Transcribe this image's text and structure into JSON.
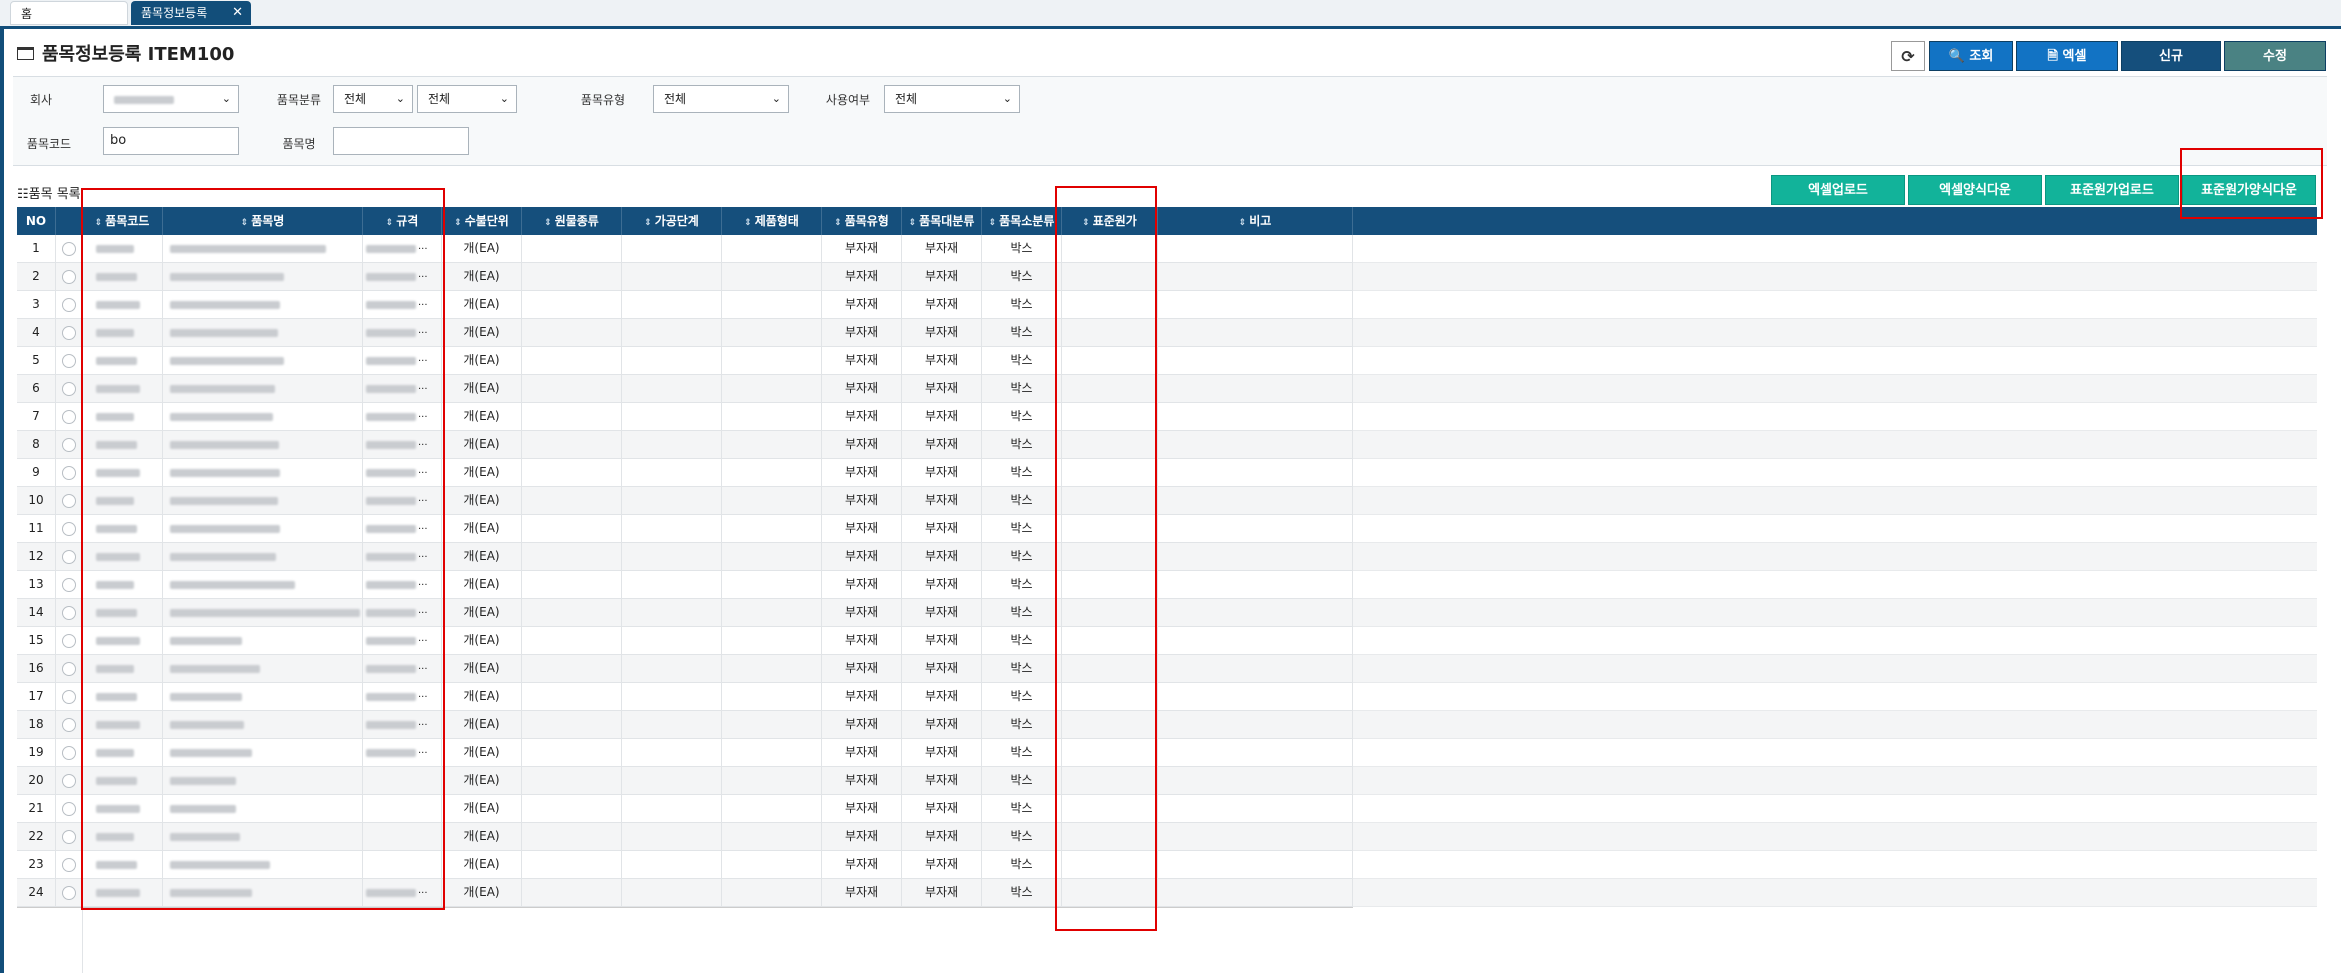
{
  "tabs": {
    "home": "홈",
    "active": "품목정보등록",
    "close": "✕"
  },
  "page": {
    "title": "품목정보등록 ITEM100"
  },
  "toolbar": {
    "refresh": "⟳",
    "search": "🔍 조회",
    "excel": "🗎 엑셀",
    "new": "신규",
    "edit": "수정"
  },
  "filters": {
    "company_label": "회사",
    "category_label": "품목분류",
    "category_value_1": "전체",
    "category_value_2": "전체",
    "type_label": "품목유형",
    "type_value": "전체",
    "use_label": "사용여부",
    "use_value": "전체",
    "code_label": "품목코드",
    "code_value": "bo",
    "name_label": "품목명",
    "name_value": ""
  },
  "list": {
    "title": "품목 목록",
    "buttons": {
      "excel_upload": "엑셀업로드",
      "excel_form_download": "엑셀양식다운",
      "std_cost_upload": "표준원가업로드",
      "std_cost_form_download": "표준원가양식다운"
    }
  },
  "grid": {
    "headers": {
      "no": "NO",
      "code": "품목코드",
      "name": "품목명",
      "spec": "규격",
      "unit": "수불단위",
      "material": "원물종류",
      "process": "가공단계",
      "shape": "제품형태",
      "item_type": "품목유형",
      "major": "품목대분류",
      "minor": "품목소분류",
      "std_cost": "표준원가",
      "note": "비고"
    },
    "rows": [
      {
        "no": "1",
        "unit": "개(EA)",
        "item_type": "부자재",
        "major": "부자재",
        "minor": "박스",
        "std_cost": "",
        "note": ""
      },
      {
        "no": "2",
        "unit": "개(EA)",
        "item_type": "부자재",
        "major": "부자재",
        "minor": "박스",
        "std_cost": "",
        "note": ""
      },
      {
        "no": "3",
        "unit": "개(EA)",
        "item_type": "부자재",
        "major": "부자재",
        "minor": "박스",
        "std_cost": "",
        "note": ""
      },
      {
        "no": "4",
        "unit": "개(EA)",
        "item_type": "부자재",
        "major": "부자재",
        "minor": "박스",
        "std_cost": "",
        "note": ""
      },
      {
        "no": "5",
        "unit": "개(EA)",
        "item_type": "부자재",
        "major": "부자재",
        "minor": "박스",
        "std_cost": "",
        "note": ""
      },
      {
        "no": "6",
        "unit": "개(EA)",
        "item_type": "부자재",
        "major": "부자재",
        "minor": "박스",
        "std_cost": "",
        "note": ""
      },
      {
        "no": "7",
        "unit": "개(EA)",
        "item_type": "부자재",
        "major": "부자재",
        "minor": "박스",
        "std_cost": "",
        "note": ""
      },
      {
        "no": "8",
        "unit": "개(EA)",
        "item_type": "부자재",
        "major": "부자재",
        "minor": "박스",
        "std_cost": "",
        "note": ""
      },
      {
        "no": "9",
        "unit": "개(EA)",
        "item_type": "부자재",
        "major": "부자재",
        "minor": "박스",
        "std_cost": "",
        "note": ""
      },
      {
        "no": "10",
        "unit": "개(EA)",
        "item_type": "부자재",
        "major": "부자재",
        "minor": "박스",
        "std_cost": "",
        "note": ""
      },
      {
        "no": "11",
        "unit": "개(EA)",
        "item_type": "부자재",
        "major": "부자재",
        "minor": "박스",
        "std_cost": "",
        "note": ""
      },
      {
        "no": "12",
        "unit": "개(EA)",
        "item_type": "부자재",
        "major": "부자재",
        "minor": "박스",
        "std_cost": "",
        "note": ""
      },
      {
        "no": "13",
        "unit": "개(EA)",
        "item_type": "부자재",
        "major": "부자재",
        "minor": "박스",
        "std_cost": "",
        "note": ""
      },
      {
        "no": "14",
        "unit": "개(EA)",
        "item_type": "부자재",
        "major": "부자재",
        "minor": "박스",
        "std_cost": "",
        "note": ""
      },
      {
        "no": "15",
        "unit": "개(EA)",
        "item_type": "부자재",
        "major": "부자재",
        "minor": "박스",
        "std_cost": "",
        "note": ""
      },
      {
        "no": "16",
        "unit": "개(EA)",
        "item_type": "부자재",
        "major": "부자재",
        "minor": "박스",
        "std_cost": "",
        "note": ""
      },
      {
        "no": "17",
        "unit": "개(EA)",
        "item_type": "부자재",
        "major": "부자재",
        "minor": "박스",
        "std_cost": "",
        "note": ""
      },
      {
        "no": "18",
        "unit": "개(EA)",
        "item_type": "부자재",
        "major": "부자재",
        "minor": "박스",
        "std_cost": "",
        "note": ""
      },
      {
        "no": "19",
        "unit": "개(EA)",
        "item_type": "부자재",
        "major": "부자재",
        "minor": "박스",
        "std_cost": "",
        "note": ""
      },
      {
        "no": "20",
        "unit": "개(EA)",
        "item_type": "부자재",
        "major": "부자재",
        "minor": "박스",
        "std_cost": "",
        "note": ""
      },
      {
        "no": "21",
        "unit": "개(EA)",
        "item_type": "부자재",
        "major": "부자재",
        "minor": "박스",
        "std_cost": "",
        "note": ""
      },
      {
        "no": "22",
        "unit": "개(EA)",
        "item_type": "부자재",
        "major": "부자재",
        "minor": "박스",
        "std_cost": "",
        "note": ""
      },
      {
        "no": "23",
        "unit": "개(EA)",
        "item_type": "부자재",
        "major": "부자재",
        "minor": "박스",
        "std_cost": "",
        "note": ""
      },
      {
        "no": "24",
        "unit": "개(EA)",
        "item_type": "부자재",
        "major": "부자재",
        "minor": "박스",
        "std_cost": "",
        "note": ""
      }
    ]
  },
  "colors": {
    "header_bg": "#154f7c",
    "accent_blue": "#1273c4",
    "green_button": "#12b39a",
    "edit_button": "#4a8283",
    "highlight": "#e00000"
  }
}
